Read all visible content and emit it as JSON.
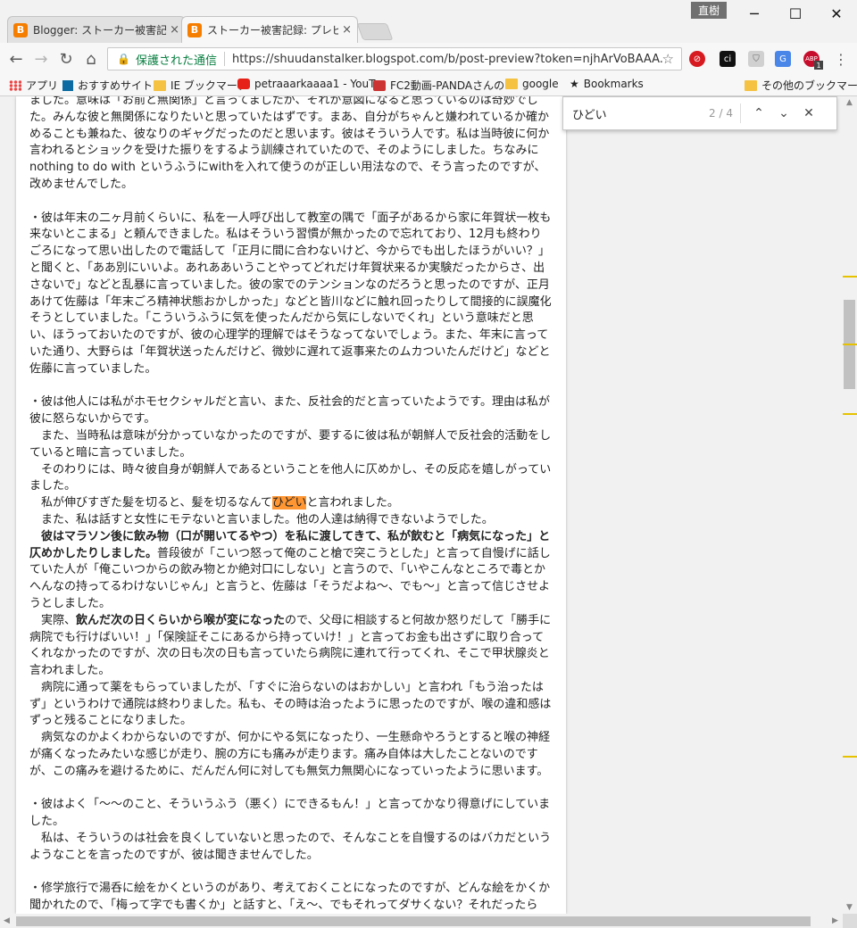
{
  "window": {
    "user_name": "直樹",
    "controls": {
      "minimize": "─",
      "maximize": "☐",
      "close": "✕"
    }
  },
  "tabs": [
    {
      "favicon": "B",
      "label": "Blogger: ストーカー被害記録",
      "close": "×"
    },
    {
      "favicon": "B",
      "label": "ストーカー被害記録: プレビュー",
      "close": "×"
    }
  ],
  "toolbar": {
    "back": "←",
    "forward": "→",
    "reload": "↻",
    "home": "⌂",
    "lock_icon": "🔒",
    "secure_label": "保護された通信",
    "url": "https://shuudanstalker.blogspot.com/b/post-preview?token=njhArVoBAAA.tK",
    "bookmark_star": "☆",
    "menu": "⋮",
    "extensions": [
      {
        "icon": "trend-micro-icon",
        "glyph": "⊘",
        "color": "#d71920"
      },
      {
        "icon": "ci-icon",
        "glyph": "ci",
        "color": "#111111"
      },
      {
        "icon": "shield-icon",
        "glyph": "⛉",
        "color": "#b0b0b0"
      },
      {
        "icon": "translate-icon",
        "glyph": "G",
        "color": "#4a86e8"
      },
      {
        "icon": "adblock-plus-icon",
        "glyph": "ABP",
        "color": "#c70d2c",
        "badge": "1"
      }
    ]
  },
  "bookmarks": {
    "items": [
      {
        "icon": "apps-icon",
        "label": "アプリ"
      },
      {
        "icon": "bing-icon",
        "label": "おすすめサイト"
      },
      {
        "icon": "folder-icon",
        "label": "IE ブックマーク"
      },
      {
        "icon": "youtube-icon",
        "label": "petraaarkaaaa1 - YouT"
      },
      {
        "icon": "fc2-icon",
        "label": "FC2動画-PANDAさんの"
      },
      {
        "icon": "folder-icon",
        "label": "google"
      },
      {
        "icon": "star-icon",
        "label": "Bookmarks"
      }
    ],
    "other": "その他のブックマーク"
  },
  "find_bar": {
    "query": "ひどい",
    "count": "2 / 4",
    "prev": "⌃",
    "next": "⌄",
    "close": "✕"
  },
  "article": {
    "p1_l1": "ました。意味は「お前と無関係」と言ってましたが、それが意図になると思っているのは奇妙でし",
    "p1_l2": "た。みんな彼と無関係になりたいと思っていたはずです。まあ、自分がちゃんと嫌われているか確か",
    "p1_l3": "めることも兼ねた、彼なりのギャグだったのだと思います。彼はそういう人です。私は当時彼に何か",
    "p1_l4": "言われるとショックを受けた振りをするよう訓練されていたので、そのようにしました。ちなみに",
    "p1_l5": "nothing to do with というふうにwithを入れて使うのが正しい用法なので、そう言ったのですが、",
    "p1_l6": "改めませんでした。",
    "p2_l1": "・彼は年末の二ヶ月前くらいに、私を一人呼び出して教室の隅で「面子があるから家に年賀状一枚も",
    "p2_l2": "来ないとこまる」と頼んできました。私はそういう習慣が無かったので忘れており、12月も終わり",
    "p2_l3": "ごろになって思い出したので電話して「正月に間に合わないけど、今からでも出したほうがいい？」",
    "p2_l4": "と聞くと、「ああ別にいいよ。あれああいうことやってどれだけ年賀状来るか実験だったからさ、出",
    "p2_l5": "さないで」などと乱暴に言っていました。彼の家でのテンションなのだろうと思ったのですが、正月",
    "p2_l6": "あけて佐藤は「年末ごろ精神状態おかしかった」などと皆川などに触れ回ったりして間接的に誤魔化",
    "p2_l7": "そうとしていました。「こういうふうに気を使ったんだから気にしないでくれ」という意味だと思",
    "p2_l8": "い、ほうっておいたのですが、彼の心理学的理解ではそうなってないでしょう。また、年末に言って",
    "p2_l9": "いた通り、大野らは「年賀状送ったんだけど、微妙に遅れて返事来たのムカついたんだけど」などと",
    "p2_l10": "佐藤に言っていました。",
    "p3_l1": "・彼は他人には私がホモセクシャルだと言い、また、反社会的だと言っていたようです。理由は私が",
    "p3_l2": "彼に怒らないからです。",
    "p3_l3": "　また、当時私は意味が分かっていなかったのですが、要するに彼は私が朝鮮人で反社会的活動をし",
    "p3_l4": "ていると暗に言っていました。",
    "p3_l5": "　そのわりには、時々彼自身が朝鮮人であるということを他人に仄めかし、その反応を嬉しがってい",
    "p3_l6": "ました。",
    "p3_l7_pre": "　私が伸びすぎた髪を切ると、髪を切るなんて",
    "p3_l7_hl": "ひどい",
    "p3_l7_post": "と言われました。",
    "p3_l8": "　また、私は話すと女性にモテないと言いました。他の人達は納得できないようでした。",
    "p3_l9_bold": "　彼はマラソン後に飲み物（口が開いてるやつ）を私に渡してきて、私が飲むと「病気になった」と",
    "p3_l10_bold": "仄めかしたりしました。",
    "p3_l10_rest": "普段彼が「こいつ怒って俺のこと槍で突こうとした」と言って自慢げに話し",
    "p3_l11": "ていた人が「俺こいつからの飲み物とか絶対口にしない」と言うので、「いやこんなところで毒とか",
    "p3_l12": "へんなの持ってるわけないじゃん」と言うと、佐藤は「そうだよね～、でも～」と言って信じさせよ",
    "p3_l13": "うとしました。",
    "p3_l14_pre": "　実際、",
    "p3_l14_bold": "飲んだ次の日くらいから喉が変になった",
    "p3_l14_post": "ので、父母に相談すると何故か怒りだして「勝手に",
    "p3_l15": "病院でも行けばいい！」「保険証そこにあるから持っていけ！」と言ってお金も出さずに取り合って",
    "p3_l16": "くれなかったのですが、次の日も次の日も言っていたら病院に連れて行ってくれ、そこで甲状腺炎と",
    "p3_l17": "言われました。",
    "p3_l18": "　病院に通って薬をもらっていましたが、「すぐに治らないのはおかしい」と言われ「もう治ったは",
    "p3_l19": "ず」というわけで通院は終わりました。私も、その時は治ったように思ったのですが、喉の違和感は",
    "p3_l20": "ずっと残ることになりました。",
    "p3_l21": "　病気なのかよくわからないのですが、何かにやる気になったり、一生懸命やろうとすると喉の神経",
    "p3_l22": "が痛くなったみたいな感じが走り、腕の方にも痛みが走ります。痛み自体は大したことないのです",
    "p3_l23": "が、この痛みを避けるために、だんだん何に対しても無気力無関心になっていったように思います。",
    "p4_l1": "・彼はよく「～～のこと、そういうふう（悪く）にできるもん！」と言ってかなり得意げにしていま",
    "p4_l2": "した。",
    "p4_l3": "　私は、そういうのは社会を良くしていないと思ったので、そんなことを自慢するのはバカだという",
    "p4_l4": "ようなことを言ったのですが、彼は聞きませんでした。",
    "p5_l1": "・修学旅行で湯呑に絵をかくというのがあり、考えておくことになったのですが、どんな絵をかくか",
    "p5_l2": "聞かれたので、「梅って字でも書くか」と話すと、「え～、でもそれってダサくない？それだったら"
  },
  "scrollbar": {
    "up_arrow": "▲",
    "down_arrow": "▼",
    "left_arrow": "◀",
    "right_arrow": "▶",
    "position_fraction": 0.25,
    "match_marker_color": "#e6c200"
  }
}
